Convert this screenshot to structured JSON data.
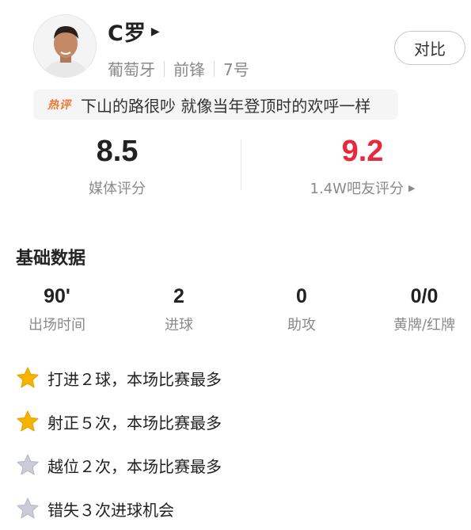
{
  "player": {
    "name": "C罗",
    "country": "葡萄牙",
    "position": "前锋",
    "number": "7号"
  },
  "compare_button": "对比",
  "hot_comment": {
    "tag": "热评",
    "text": "下山的路很吵 就像当年登顶时的欢呼一样"
  },
  "ratings": {
    "media_score": "8.5",
    "media_label": "媒体评分",
    "fans_score": "9.2",
    "fans_label": "1.4W吧友评分"
  },
  "basic_stats": {
    "title": "基础数据",
    "items": [
      {
        "value": "90'",
        "label": "出场时间"
      },
      {
        "value": "2",
        "label": "进球"
      },
      {
        "value": "0",
        "label": "助攻"
      },
      {
        "value": "0/0",
        "label": "黄牌/红牌"
      }
    ]
  },
  "highlights": [
    {
      "text": "打进２球，本场比赛最多",
      "icon": "star-gold-icon"
    },
    {
      "text": "射正５次，本场比赛最多",
      "icon": "star-gold-icon"
    },
    {
      "text": "越位２次，本场比赛最多",
      "icon": "star-gray-icon"
    },
    {
      "text": "错失３次进球机会",
      "icon": "star-gray-icon"
    }
  ],
  "colors": {
    "fans_score": "#e8283c",
    "hot_tag": "#f3762e",
    "star_gold": "#f5b400",
    "star_gray": "#c9ccd6"
  }
}
